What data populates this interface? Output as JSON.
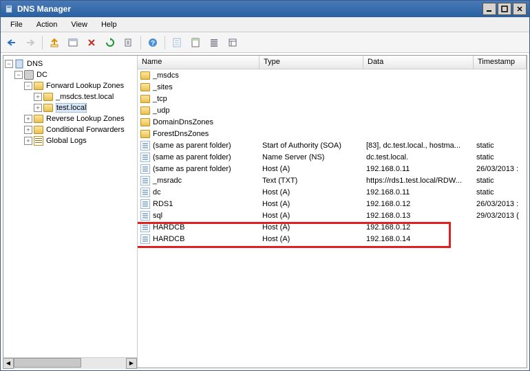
{
  "window": {
    "title": "DNS Manager"
  },
  "menu": {
    "file": "File",
    "action": "Action",
    "view": "View",
    "help": "Help"
  },
  "tree": {
    "root": "DNS",
    "server": "DC",
    "forward": "Forward Lookup Zones",
    "zone_msdcs": "_msdcs.test.local",
    "zone_test": "test.local",
    "reverse": "Reverse Lookup Zones",
    "cond": "Conditional Forwarders",
    "logs": "Global Logs"
  },
  "columns": {
    "name": "Name",
    "type": "Type",
    "data": "Data",
    "timestamp": "Timestamp"
  },
  "folders": [
    {
      "name": "_msdcs"
    },
    {
      "name": "_sites"
    },
    {
      "name": "_tcp"
    },
    {
      "name": "_udp"
    },
    {
      "name": "DomainDnsZones"
    },
    {
      "name": "ForestDnsZones"
    }
  ],
  "records": [
    {
      "name": "(same as parent folder)",
      "type": "Start of Authority (SOA)",
      "data": "[83], dc.test.local., hostma...",
      "ts": "static"
    },
    {
      "name": "(same as parent folder)",
      "type": "Name Server (NS)",
      "data": "dc.test.local.",
      "ts": "static"
    },
    {
      "name": "(same as parent folder)",
      "type": "Host (A)",
      "data": "192.168.0.11",
      "ts": "26/03/2013 :"
    },
    {
      "name": "_msradc",
      "type": "Text (TXT)",
      "data": "https://rds1.test.local/RDW...",
      "ts": "static"
    },
    {
      "name": "dc",
      "type": "Host (A)",
      "data": "192.168.0.11",
      "ts": "static"
    },
    {
      "name": "RDS1",
      "type": "Host (A)",
      "data": "192.168.0.12",
      "ts": "26/03/2013 :"
    },
    {
      "name": "sql",
      "type": "Host (A)",
      "data": "192.168.0.13",
      "ts": "29/03/2013 ("
    },
    {
      "name": "HARDCB",
      "type": "Host (A)",
      "data": "192.168.0.12",
      "ts": ""
    },
    {
      "name": "HARDCB",
      "type": "Host (A)",
      "data": "192.168.0.14",
      "ts": ""
    }
  ]
}
